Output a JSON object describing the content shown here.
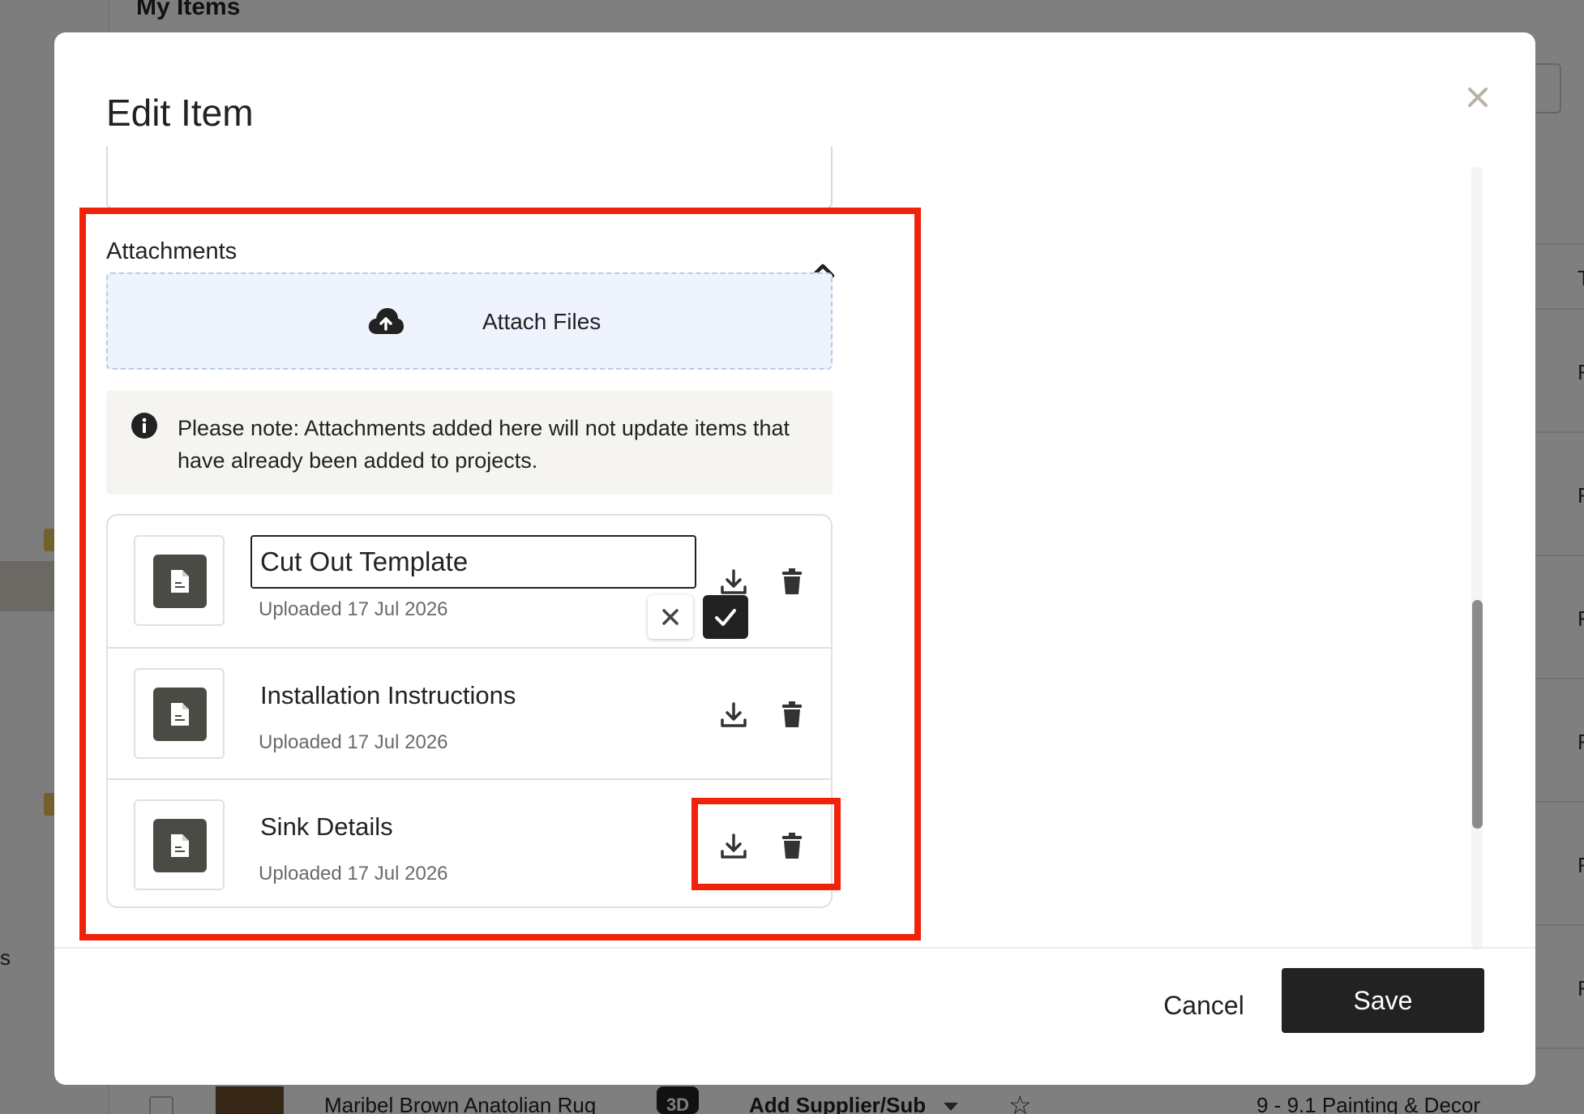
{
  "background": {
    "page_title": "My Items",
    "sidebar_letter": "s",
    "row_letter": "F",
    "row_letter_first": "T",
    "bottom_row": {
      "item_name": "Maribel Brown Anatolian Rug",
      "badge": "3D",
      "supplier": "Add Supplier/Sub",
      "category": "9 - 9.1 Painting & Decor"
    }
  },
  "modal": {
    "title": "Edit Item",
    "close_icon": "close-icon"
  },
  "attachments": {
    "section_title": "Attachments",
    "attach_label": "Attach Files",
    "note": "Please note: Attachments added here will not update items that have already been added to projects.",
    "files": [
      {
        "name": "Cut Out Template",
        "uploaded": "Uploaded 17 Jul 2026",
        "editing": true
      },
      {
        "name": "Installation Instructions",
        "uploaded": "Uploaded 17 Jul 2026",
        "editing": false
      },
      {
        "name": "Sink Details",
        "uploaded": "Uploaded 17 Jul 2026",
        "editing": false
      }
    ]
  },
  "footer": {
    "cancel_label": "Cancel",
    "save_label": "Save"
  },
  "colors": {
    "highlight": "#f0230a",
    "dark": "#222222",
    "dropzone_bg": "#eef3fd"
  }
}
